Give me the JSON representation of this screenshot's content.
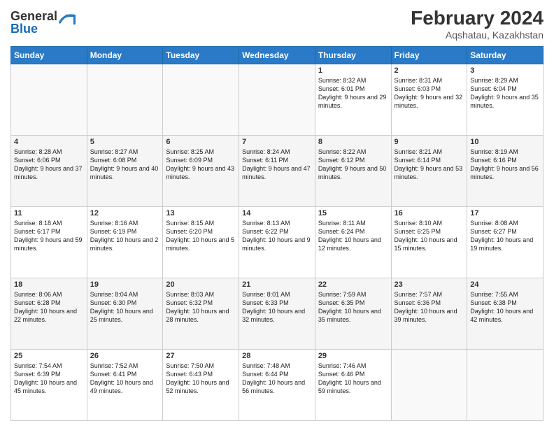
{
  "logo": {
    "general": "General",
    "blue": "Blue"
  },
  "title": {
    "main": "February 2024",
    "sub": "Aqshatau, Kazakhstan"
  },
  "weekdays": [
    "Sunday",
    "Monday",
    "Tuesday",
    "Wednesday",
    "Thursday",
    "Friday",
    "Saturday"
  ],
  "weeks": [
    [
      {
        "day": "",
        "info": ""
      },
      {
        "day": "",
        "info": ""
      },
      {
        "day": "",
        "info": ""
      },
      {
        "day": "",
        "info": ""
      },
      {
        "day": "1",
        "info": "Sunrise: 8:32 AM\nSunset: 6:01 PM\nDaylight: 9 hours and 29 minutes."
      },
      {
        "day": "2",
        "info": "Sunrise: 8:31 AM\nSunset: 6:03 PM\nDaylight: 9 hours and 32 minutes."
      },
      {
        "day": "3",
        "info": "Sunrise: 8:29 AM\nSunset: 6:04 PM\nDaylight: 9 hours and 35 minutes."
      }
    ],
    [
      {
        "day": "4",
        "info": "Sunrise: 8:28 AM\nSunset: 6:06 PM\nDaylight: 9 hours and 37 minutes."
      },
      {
        "day": "5",
        "info": "Sunrise: 8:27 AM\nSunset: 6:08 PM\nDaylight: 9 hours and 40 minutes."
      },
      {
        "day": "6",
        "info": "Sunrise: 8:25 AM\nSunset: 6:09 PM\nDaylight: 9 hours and 43 minutes."
      },
      {
        "day": "7",
        "info": "Sunrise: 8:24 AM\nSunset: 6:11 PM\nDaylight: 9 hours and 47 minutes."
      },
      {
        "day": "8",
        "info": "Sunrise: 8:22 AM\nSunset: 6:12 PM\nDaylight: 9 hours and 50 minutes."
      },
      {
        "day": "9",
        "info": "Sunrise: 8:21 AM\nSunset: 6:14 PM\nDaylight: 9 hours and 53 minutes."
      },
      {
        "day": "10",
        "info": "Sunrise: 8:19 AM\nSunset: 6:16 PM\nDaylight: 9 hours and 56 minutes."
      }
    ],
    [
      {
        "day": "11",
        "info": "Sunrise: 8:18 AM\nSunset: 6:17 PM\nDaylight: 9 hours and 59 minutes."
      },
      {
        "day": "12",
        "info": "Sunrise: 8:16 AM\nSunset: 6:19 PM\nDaylight: 10 hours and 2 minutes."
      },
      {
        "day": "13",
        "info": "Sunrise: 8:15 AM\nSunset: 6:20 PM\nDaylight: 10 hours and 5 minutes."
      },
      {
        "day": "14",
        "info": "Sunrise: 8:13 AM\nSunset: 6:22 PM\nDaylight: 10 hours and 9 minutes."
      },
      {
        "day": "15",
        "info": "Sunrise: 8:11 AM\nSunset: 6:24 PM\nDaylight: 10 hours and 12 minutes."
      },
      {
        "day": "16",
        "info": "Sunrise: 8:10 AM\nSunset: 6:25 PM\nDaylight: 10 hours and 15 minutes."
      },
      {
        "day": "17",
        "info": "Sunrise: 8:08 AM\nSunset: 6:27 PM\nDaylight: 10 hours and 19 minutes."
      }
    ],
    [
      {
        "day": "18",
        "info": "Sunrise: 8:06 AM\nSunset: 6:28 PM\nDaylight: 10 hours and 22 minutes."
      },
      {
        "day": "19",
        "info": "Sunrise: 8:04 AM\nSunset: 6:30 PM\nDaylight: 10 hours and 25 minutes."
      },
      {
        "day": "20",
        "info": "Sunrise: 8:03 AM\nSunset: 6:32 PM\nDaylight: 10 hours and 28 minutes."
      },
      {
        "day": "21",
        "info": "Sunrise: 8:01 AM\nSunset: 6:33 PM\nDaylight: 10 hours and 32 minutes."
      },
      {
        "day": "22",
        "info": "Sunrise: 7:59 AM\nSunset: 6:35 PM\nDaylight: 10 hours and 35 minutes."
      },
      {
        "day": "23",
        "info": "Sunrise: 7:57 AM\nSunset: 6:36 PM\nDaylight: 10 hours and 39 minutes."
      },
      {
        "day": "24",
        "info": "Sunrise: 7:55 AM\nSunset: 6:38 PM\nDaylight: 10 hours and 42 minutes."
      }
    ],
    [
      {
        "day": "25",
        "info": "Sunrise: 7:54 AM\nSunset: 6:39 PM\nDaylight: 10 hours and 45 minutes."
      },
      {
        "day": "26",
        "info": "Sunrise: 7:52 AM\nSunset: 6:41 PM\nDaylight: 10 hours and 49 minutes."
      },
      {
        "day": "27",
        "info": "Sunrise: 7:50 AM\nSunset: 6:43 PM\nDaylight: 10 hours and 52 minutes."
      },
      {
        "day": "28",
        "info": "Sunrise: 7:48 AM\nSunset: 6:44 PM\nDaylight: 10 hours and 56 minutes."
      },
      {
        "day": "29",
        "info": "Sunrise: 7:46 AM\nSunset: 6:46 PM\nDaylight: 10 hours and 59 minutes."
      },
      {
        "day": "",
        "info": ""
      },
      {
        "day": "",
        "info": ""
      }
    ]
  ]
}
